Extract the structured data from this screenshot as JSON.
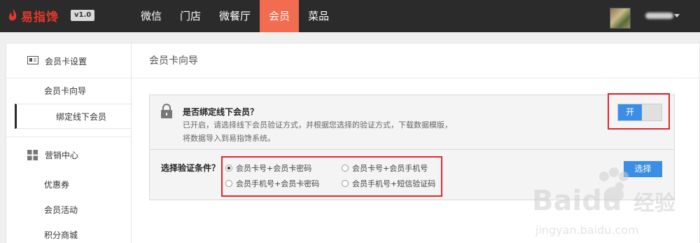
{
  "brand": {
    "name": "易指馋",
    "version": "v1.0",
    "accent": "#e5382d"
  },
  "nav": {
    "items": [
      {
        "label": "微信",
        "active": false
      },
      {
        "label": "门店",
        "active": false
      },
      {
        "label": "微餐厅",
        "active": false
      },
      {
        "label": "会员",
        "active": true
      },
      {
        "label": "菜品",
        "active": false
      }
    ],
    "active_color": "#f26c4f"
  },
  "sidebar": {
    "groups": [
      {
        "title": "会员卡设置",
        "icon": "member-card-icon",
        "items": [
          {
            "label": "会员卡向导",
            "active": false
          },
          {
            "label": "绑定线下会员",
            "active": true
          }
        ]
      },
      {
        "title": "营销中心",
        "icon": "grid-icon",
        "items": [
          {
            "label": "优惠券",
            "active": false
          },
          {
            "label": "会员活动",
            "active": false
          },
          {
            "label": "积分商城",
            "active": false
          }
        ]
      }
    ]
  },
  "main": {
    "title": "会员卡向导",
    "bind": {
      "title": "是否绑定线下会员？",
      "desc_line1": "已开启，请选择线下会员验证方式，并根据您选择的验证方式，下载数据模版，",
      "desc_line2": "将数据导入到易指馋系统。",
      "toggle_label": "开",
      "toggle_on": true
    },
    "verify": {
      "label": "选择验证条件？",
      "options": [
        {
          "label": "会员卡号+会员卡密码",
          "checked": true
        },
        {
          "label": "会员卡号+会员手机号",
          "checked": false
        },
        {
          "label": "会员手机号+会员卡密码",
          "checked": false
        },
        {
          "label": "会员手机号+短信验证码",
          "checked": false
        }
      ],
      "button": "选择"
    }
  },
  "watermark": {
    "brand": "Baidu",
    "cn": "经验",
    "url": "jingyan.baidu.com"
  },
  "colors": {
    "primary": "#3a8ee6",
    "highlight": "#e4262c"
  }
}
